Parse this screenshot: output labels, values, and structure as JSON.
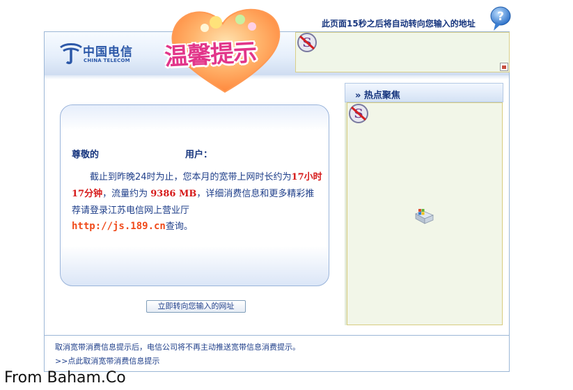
{
  "top_notice": "此页面15秒之后将自动转向您输入的地址",
  "logo": {
    "cn": "中国电信",
    "en": "CHINA TELECOM"
  },
  "banner_title": "温馨提示",
  "sidebar": {
    "title": "» 热点聚焦"
  },
  "message": {
    "greeting": "尊敬的",
    "user_label": "用户：",
    "body_prefix": "截止到昨晚24时为止，您本月的宽带上网时长约为",
    "duration": "17小时 17分钟",
    "body_mid": "，流量约为",
    "traffic": "9386 MB",
    "body_suffix": "，详细消费信息和更多精彩推荐请登录江苏电信网上营业厅",
    "url": "http://js.189.cn",
    "url_suffix": "查询。"
  },
  "redirect_button": "立即转向您输入的网址",
  "footer": {
    "text": "取消宽带消费信息提示后，电信公司将不再主动推送宽带信息消费提示。",
    "link": ">>点此取消宽带消费信息提示"
  },
  "watermark": "From Baham.Co",
  "colors": {
    "brand_blue": "#16357e",
    "highlight_red": "#d61a1a",
    "link_orange": "#f04b1b",
    "heart_pink": "#e2368a"
  },
  "icons": [
    "help-icon",
    "no-ads-icon",
    "windows-icon",
    "image-icon",
    "telecom-logo"
  ]
}
